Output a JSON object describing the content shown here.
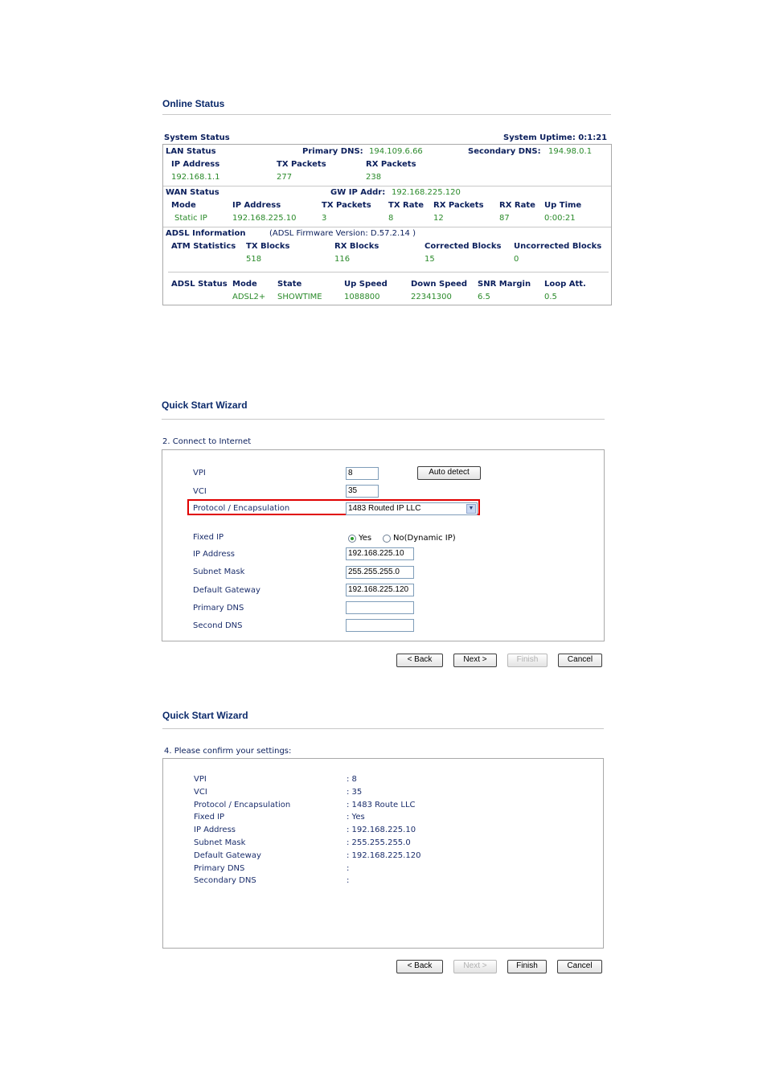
{
  "online_status": {
    "title": "Online Status",
    "system_status_label": "System Status",
    "uptime_label": "System Uptime: 0:1:21",
    "lan": {
      "label": "LAN Status",
      "primary_dns_label": "Primary DNS:",
      "primary_dns": "194.109.6.66",
      "secondary_dns_label": "Secondary DNS:",
      "secondary_dns": "194.98.0.1",
      "headers": [
        "IP Address",
        "TX Packets",
        "RX Packets"
      ],
      "values": [
        "192.168.1.1",
        "277",
        "238"
      ]
    },
    "wan": {
      "label": "WAN Status",
      "gw_label": "GW IP Addr:",
      "gw": "192.168.225.120",
      "headers": [
        "Mode",
        "IP Address",
        "TX Packets",
        "TX Rate",
        "RX Packets",
        "RX Rate",
        "Up Time"
      ],
      "values": [
        "Static IP",
        "192.168.225.10",
        "3",
        "8",
        "12",
        "87",
        "0:00:21"
      ]
    },
    "adsl_info": {
      "label": "ADSL Information",
      "firmware": "(ADSL Firmware Version:  D.57.2.14 )",
      "atm_label": "ATM Statistics",
      "headers": [
        "TX Blocks",
        "RX Blocks",
        "Corrected Blocks",
        "Uncorrected Blocks"
      ],
      "values": [
        "518",
        "116",
        "15",
        "0"
      ]
    },
    "adsl_status": {
      "label": "ADSL Status",
      "headers": [
        "Mode",
        "State",
        "Up Speed",
        "Down Speed",
        "SNR Margin",
        "Loop Att."
      ],
      "values": [
        "ADSL2+",
        "SHOWTIME",
        "1088800",
        "22341300",
        "6.5",
        "0.5"
      ]
    }
  },
  "wizard2": {
    "title": "Quick Start Wizard",
    "step": "2. Connect to Internet",
    "vpi_label": "VPI",
    "vpi": "8",
    "auto_detect": "Auto detect",
    "vci_label": "VCI",
    "vci": "35",
    "protocol_label": "Protocol / Encapsulation",
    "protocol": "1483 Routed IP LLC",
    "fixed_ip_label": "Fixed IP",
    "yes": "Yes",
    "no": "No(Dynamic IP)",
    "ip_label": "IP Address",
    "ip": "192.168.225.10",
    "mask_label": "Subnet Mask",
    "mask": "255.255.255.0",
    "gw_label": "Default Gateway",
    "gw": "192.168.225.120",
    "pdns_label": "Primary DNS",
    "pdns": "",
    "sdns_label": "Second DNS",
    "sdns": "",
    "buttons": {
      "back": "< Back",
      "next": "Next >",
      "finish": "Finish",
      "cancel": "Cancel"
    }
  },
  "wizard4": {
    "title": "Quick Start Wizard",
    "step": "4. Please confirm your settings:",
    "rows": [
      {
        "label": "VPI",
        "value": ": 8"
      },
      {
        "label": "VCI",
        "value": ": 35"
      },
      {
        "label": "Protocol / Encapsulation",
        "value": ": 1483 Route LLC"
      },
      {
        "label": "Fixed IP",
        "value": ": Yes"
      },
      {
        "label": "IP Address",
        "value": ": 192.168.225.10"
      },
      {
        "label": "Subnet Mask",
        "value": ": 255.255.255.0"
      },
      {
        "label": "Default Gateway",
        "value": ": 192.168.225.120"
      },
      {
        "label": "Primary DNS",
        "value": ":"
      },
      {
        "label": "Secondary DNS",
        "value": ":"
      }
    ],
    "buttons": {
      "back": "< Back",
      "next": "Next >",
      "finish": "Finish",
      "cancel": "Cancel"
    }
  }
}
